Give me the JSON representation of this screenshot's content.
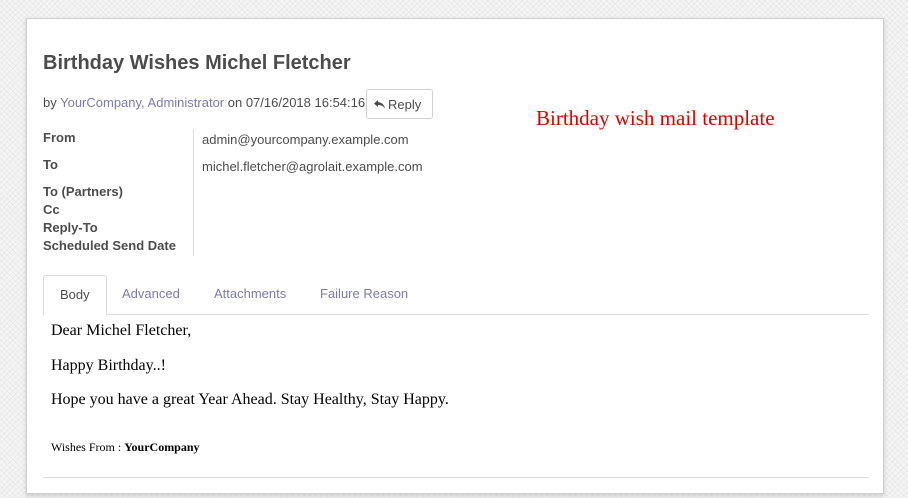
{
  "mail": {
    "subject": "Birthday Wishes Michel Fletcher",
    "by_prefix": "by ",
    "author": "YourCompany, Administrator",
    "date_text": " on 07/16/2018 16:54:16",
    "reply_label": "Reply"
  },
  "annotation": "Birthday wish mail template",
  "fields": {
    "from_label": "From",
    "from_value": "admin@yourcompany.example.com",
    "to_label": "To",
    "to_value": "michel.fletcher@agrolait.example.com",
    "to_partners_label": "To (Partners)",
    "cc_label": "Cc",
    "reply_to_label": "Reply-To",
    "scheduled_label": "Scheduled Send Date"
  },
  "tabs": [
    {
      "label": "Body",
      "active": true
    },
    {
      "label": "Advanced",
      "active": false
    },
    {
      "label": "Attachments",
      "active": false
    },
    {
      "label": "Failure Reason",
      "active": false
    }
  ],
  "body": {
    "greeting": "Dear Michel Fletcher,",
    "line1": "Happy Birthday..!",
    "line2": "Hope you have a great Year Ahead. Stay Healthy, Stay Happy.",
    "sig_prefix": "Wishes From : ",
    "sig_company": "YourCompany"
  },
  "colors": {
    "link": "#7c7bad",
    "text": "#4c4c4c",
    "annotation": "#e00000"
  },
  "icons": {
    "reply": "reply-arrow-icon"
  }
}
